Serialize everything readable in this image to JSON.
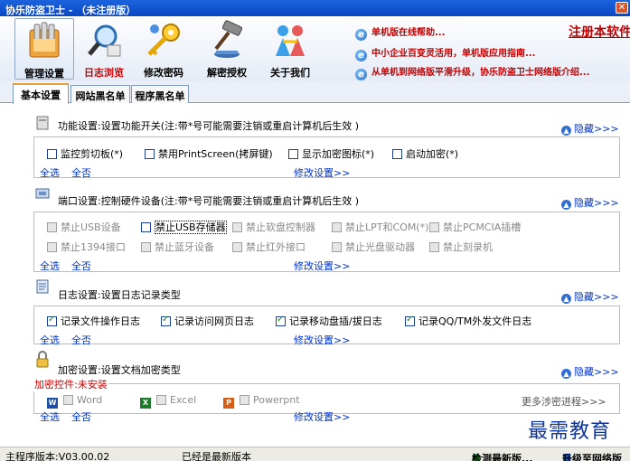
{
  "window": {
    "title": "协乐防盗卫士 - （未注册版）",
    "close_glyph": "✕"
  },
  "toolbar": {
    "items": [
      {
        "label": "管理设置",
        "icon": "folder-icon"
      },
      {
        "label": "日志浏览",
        "icon": "magnifier-icon"
      },
      {
        "label": "修改密码",
        "icon": "key-icon"
      },
      {
        "label": "解密授权",
        "icon": "gavel-icon"
      },
      {
        "label": "关于我们",
        "icon": "people-icon"
      }
    ],
    "links": [
      "单机版在线帮助...",
      "中小企业百变灵活用，单机版应用指南...",
      "从单机到网络版平滑升级，协乐防盗卫士网络版介绍..."
    ],
    "register": "注册本软件"
  },
  "tabs": [
    "基本设置",
    "网站黑名单",
    "程序黑名单"
  ],
  "function_settings": {
    "title": "功能设置:设置功能开关(注:带*号可能需要注销或重启计算机后生效 )",
    "hide": "隐藏>>>",
    "options": [
      "监控剪切板(*)",
      "禁用PrintScreen(拷屏键)",
      "显示加密图标(*)",
      "启动加密(*)"
    ],
    "select_all": "全选",
    "select_none": "全否",
    "modify": "修改设置>>"
  },
  "port_settings": {
    "title": "端口设置:控制硬件设备(注:带*号可能需要注销或重启计算机后生效 )",
    "hide": "隐藏>>>",
    "row1": [
      "禁止USB设备",
      "禁止USB存储器",
      "禁止软盘控制器",
      "禁止LPT和COM(*)",
      "禁止PCMCIA插槽"
    ],
    "row2": [
      "禁止1394接口",
      "禁止蓝牙设备",
      "禁止红外接口",
      "禁止光盘驱动器",
      "禁止刻录机"
    ],
    "select_all": "全选",
    "select_none": "全否",
    "modify": "修改设置>>"
  },
  "log_settings": {
    "title": "日志设置:设置日志记录类型",
    "hide": "隐藏>>>",
    "options": [
      "记录文件操作日志",
      "记录访问网页日志",
      "记录移动盘插/拔日志",
      "记录QQ/TM外发文件日志"
    ],
    "select_all": "全选",
    "select_none": "全否",
    "modify": "修改设置>>"
  },
  "encrypt_settings": {
    "title": "加密设置:设置文档加密类型",
    "hide": "隐藏>>>",
    "status": "加密控件:未安装",
    "options": [
      {
        "label": "Word",
        "badge": "W"
      },
      {
        "label": "Excel",
        "badge": "X"
      },
      {
        "label": "Powerpnt",
        "badge": "P"
      }
    ],
    "more": "更多涉密进程>>>",
    "select_all": "全选",
    "select_none": "全否",
    "modify": "修改设置>>"
  },
  "status": {
    "version": "主程序版本:V03.00.02",
    "update_state": "已经是最新版本",
    "check_update": "检测最新版...",
    "upgrade": "升级至网络版"
  },
  "watermark": "最需教育",
  "colors": {
    "titlebar": "#0a46c4",
    "link_red": "#c00000",
    "link_blue": "#0033cc"
  }
}
